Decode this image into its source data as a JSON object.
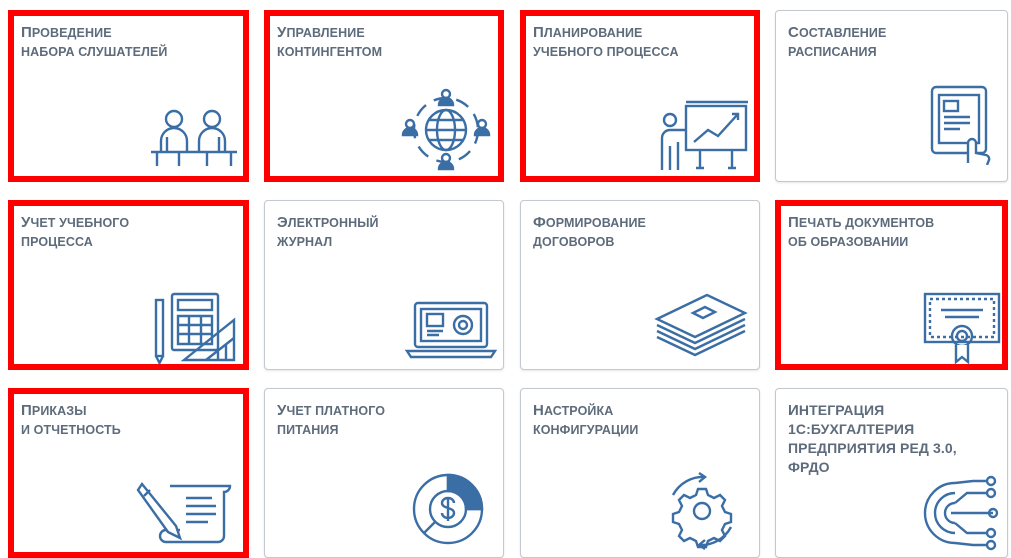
{
  "colors": {
    "accent": "#3a6ea5",
    "highlight": "#ff0000",
    "title_text": "#5d6b7b",
    "tile_border": "#c4c8cf"
  },
  "tiles": [
    {
      "line1": "Проведение",
      "line2": "набора слушателей",
      "icon": "people-at-desk-icon",
      "highlighted": true
    },
    {
      "line1": "Управление",
      "line2": "контингентом",
      "icon": "globe-people-icon",
      "highlighted": true
    },
    {
      "line1": "Планирование",
      "line2": "учебного процесса",
      "icon": "presentation-board-icon",
      "highlighted": true
    },
    {
      "line1": "Составление",
      "line2": "расписания",
      "icon": "tablet-touch-icon",
      "highlighted": false
    },
    {
      "line1": "Учет учебного",
      "line2": "процесса",
      "icon": "calculator-ruler-icon",
      "highlighted": true
    },
    {
      "line1": "Электронный",
      "line2": "журнал",
      "icon": "laptop-icon",
      "highlighted": false
    },
    {
      "line1": "Формирование",
      "line2": "договоров",
      "icon": "document-stack-icon",
      "highlighted": false
    },
    {
      "line1": "Печать документов",
      "line2": "об образовании",
      "icon": "diploma-certificate-icon",
      "highlighted": true
    },
    {
      "line1": "Приказы",
      "line2": "и отчетность",
      "icon": "pen-scroll-icon",
      "highlighted": true
    },
    {
      "line1": "Учет платного",
      "line2": "питания",
      "icon": "dollar-chart-icon",
      "highlighted": false
    },
    {
      "line1": "Настройка",
      "line2": "конфигурации",
      "icon": "gear-icon",
      "highlighted": false
    },
    {
      "line1": "Интеграция",
      "line2": "1С:Бухгалтерия",
      "line3": "предприятия ред 3.0,",
      "line4": "ФРДО",
      "icon": "integration-circuit-icon",
      "highlighted": false
    }
  ]
}
